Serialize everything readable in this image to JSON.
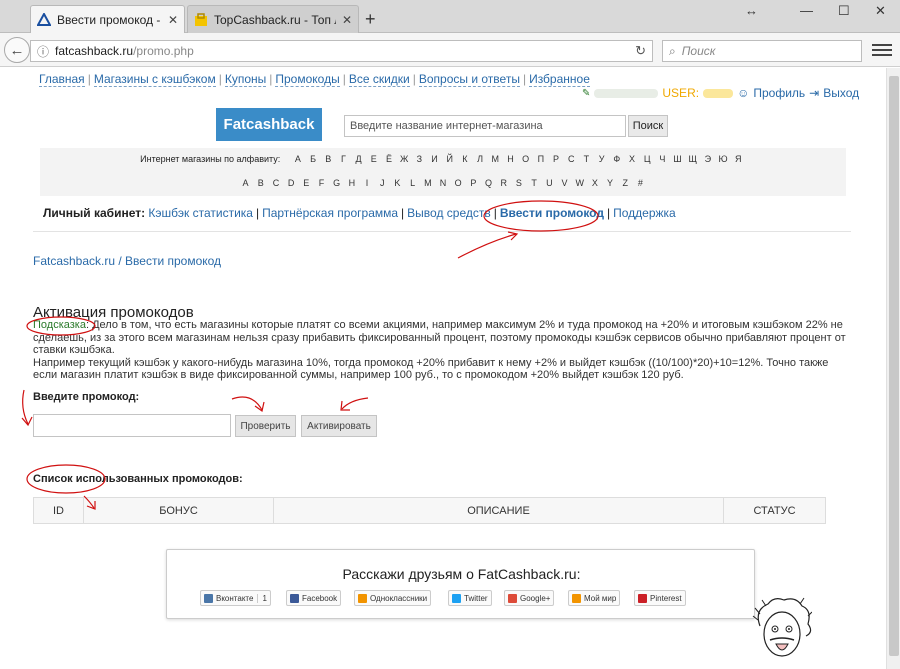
{
  "browser": {
    "tabs": [
      {
        "title": "Ввести промокод - fatcas…"
      },
      {
        "title": "TopCashback.ru - Топ лу…"
      }
    ],
    "url_host": "fatcashback.ru",
    "url_path": "/promo.php",
    "search_placeholder": "Поиск"
  },
  "site": {
    "nav": [
      "Главная",
      "Магазины с кэшбэком",
      "Купоны",
      "Промокоды",
      "Все скидки",
      "Вопросы и ответы",
      "Избранное"
    ],
    "user_label": "USER:",
    "profile_link": "Профиль",
    "logout_link": "Выход",
    "logo": "Fatcashback",
    "shop_search_placeholder": "Введите название интернет-магазина",
    "shop_search_button": "Поиск",
    "alphabet_label": "Интернет магазины по алфавиту:",
    "alphabet_ru": [
      "А",
      "Б",
      "В",
      "Г",
      "Д",
      "Е",
      "Ё",
      "Ж",
      "З",
      "И",
      "Й",
      "К",
      "Л",
      "М",
      "Н",
      "О",
      "П",
      "Р",
      "С",
      "Т",
      "У",
      "Ф",
      "Х",
      "Ц",
      "Ч",
      "Ш",
      "Щ",
      "Э",
      "Ю",
      "Я"
    ],
    "alphabet_en": [
      "A",
      "B",
      "C",
      "D",
      "E",
      "F",
      "G",
      "H",
      "I",
      "J",
      "K",
      "L",
      "M",
      "N",
      "O",
      "P",
      "Q",
      "R",
      "S",
      "T",
      "U",
      "V",
      "W",
      "X",
      "Y",
      "Z",
      "#"
    ],
    "cabinet_label": "Личный кабинет:",
    "cabinet_links": [
      "Кэшбэк статистика",
      "Партнёрская программа",
      "Вывод средств",
      "Ввести промокод",
      "Поддержка"
    ],
    "breadcrumb": "Fatcashback.ru / Ввести промокод",
    "heading": "Активация промокодов",
    "hint_label": "Подсказка",
    "hint_text": ": Дело в том, что есть магазины которые платят со всеми акциями, например максимум 2% и туда промокод на +20% и итоговым кэшбэком 22% не сделаешь, из за этого всем магазинам нельзя сразу прибавить фиксированный процент, поэтому промокоды кэшбэк сервисов обычно прибавляют процент от ставки кэшбэка.",
    "hint_text2": "Например текущий кэшбэк у какого-нибудь магазина 10%, тогда промокод +20% прибавит к нему +2% и выйдет кэшбэк ((10/100)*20)+10=12%. Точно также если магазин платит кэшбэк в виде фиксированной суммы, например 100 руб., то с промокодом +20% выйдет кэшбэк 120 руб.",
    "promo_label": "Введите промокод:",
    "check_button": "Проверить",
    "activate_button": "Активировать",
    "used_label": "Список использованных промокодов:",
    "table_headers": [
      "ID",
      "БОНУС",
      "ОПИСАНИЕ",
      "СТАТУС"
    ],
    "share_title": "Расскажи друзьям о FatCashback.ru:",
    "share_buttons": [
      {
        "label": "Вконтакте",
        "count": "1",
        "color": "#4a76a8"
      },
      {
        "label": "Facebook",
        "color": "#3b5998"
      },
      {
        "label": "Одноклассники",
        "color": "#f29400"
      },
      {
        "label": "Twitter",
        "color": "#1da1f2"
      },
      {
        "label": "Google+",
        "color": "#dd4b39"
      },
      {
        "label": "Мой мир",
        "color": "#f29400"
      },
      {
        "label": "Pinterest",
        "color": "#cb2027"
      }
    ]
  },
  "colors": {
    "link": "#2a6aa8",
    "logo_bg": "#3a8cc8",
    "annotation": "#d01010",
    "hint": "#2a7a2a"
  }
}
